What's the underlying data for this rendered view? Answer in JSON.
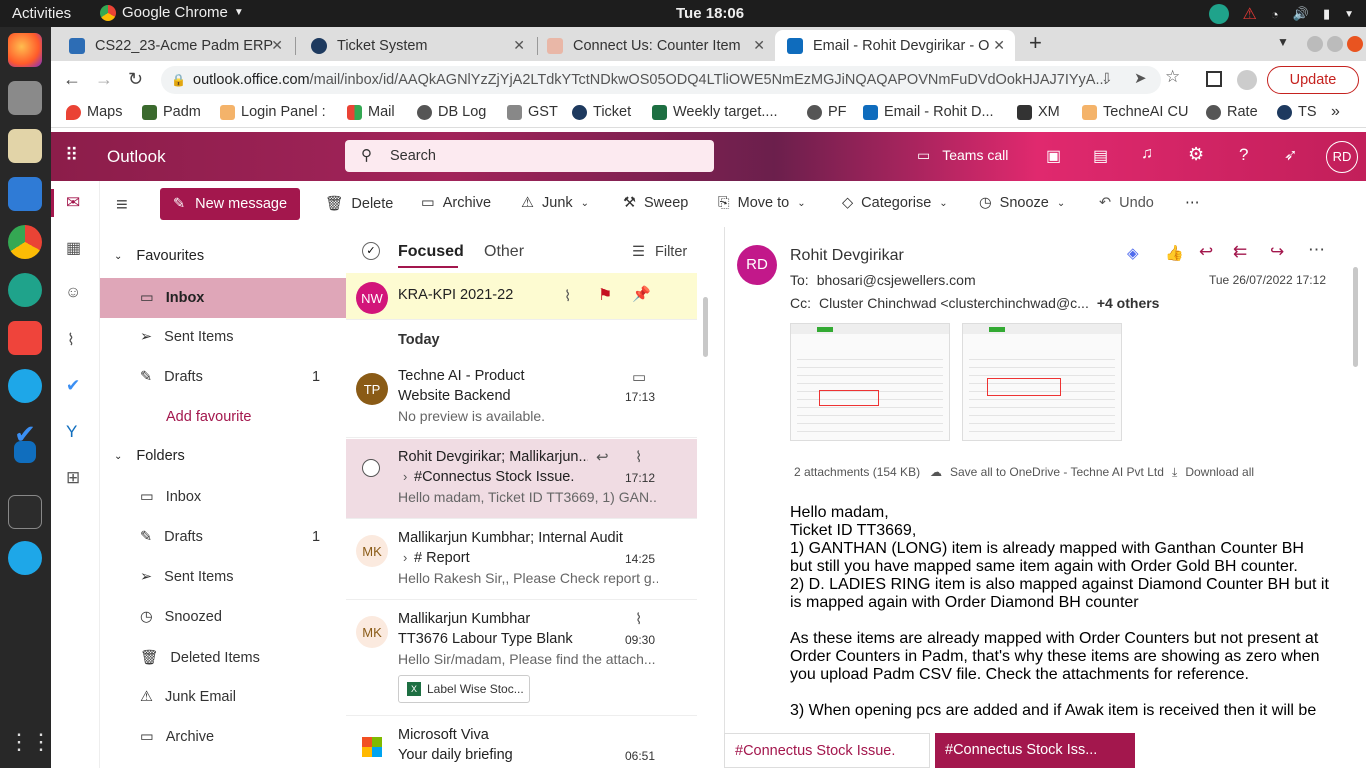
{
  "system": {
    "activities": "Activities",
    "app_name": "Google Chrome",
    "clock": "Tue 18:06"
  },
  "chrome": {
    "tabs": [
      {
        "title": "CS22_23-Acme Padm ERP"
      },
      {
        "title": "Ticket System"
      },
      {
        "title": "Connect Us: Counter Item"
      },
      {
        "title": "Email - Rohit Devgirikar - O"
      }
    ],
    "url_host": "outlook.office.com",
    "url_path": "/mail/inbox/id/AAQkAGNlYzZjYjA2LTdkYTctNDkwOS05ODQ4LTliOWE5NmEzMGJiNQAQAPOVNmFuDVdOokHJAJ7IYyA...",
    "update_label": "Update",
    "profile_initial": "",
    "bookmarks": [
      "Maps",
      "Padm",
      "Login Panel :",
      "Mail",
      "DB Log",
      "GST",
      "Ticket",
      "Weekly target....",
      "PF",
      "Email - Rohit D...",
      "XM",
      "TechneAI CU",
      "Rate",
      "TS"
    ]
  },
  "outlook": {
    "brand": "Outlook",
    "search_placeholder": "Search",
    "teams_call": "Teams call",
    "user_initials": "RD",
    "ribbon": {
      "new_message": "New message",
      "delete": "Delete",
      "archive": "Archive",
      "junk": "Junk",
      "sweep": "Sweep",
      "move_to": "Move to",
      "categorise": "Categorise",
      "snooze": "Snooze",
      "undo": "Undo"
    },
    "nav": {
      "favourites": "Favourites",
      "fav_items": [
        {
          "label": "Inbox",
          "count": ""
        },
        {
          "label": "Sent Items",
          "count": ""
        },
        {
          "label": "Drafts",
          "count": "1"
        }
      ],
      "add_favourite": "Add favourite",
      "folders": "Folders",
      "folder_items": [
        {
          "label": "Inbox",
          "count": ""
        },
        {
          "label": "Drafts",
          "count": "1"
        },
        {
          "label": "Sent Items",
          "count": ""
        },
        {
          "label": "Snoozed",
          "count": ""
        },
        {
          "label": "Deleted Items",
          "count": ""
        },
        {
          "label": "Junk Email",
          "count": ""
        },
        {
          "label": "Archive",
          "count": ""
        }
      ]
    },
    "list": {
      "focused": "Focused",
      "other": "Other",
      "filter": "Filter",
      "pinned": {
        "initials": "NW",
        "subject": "KRA-KPI 2021-22"
      },
      "today": "Today",
      "messages": [
        {
          "initials": "TP",
          "sender": "Techne AI - Product",
          "subject": "Website Backend",
          "preview": "No preview is available.",
          "time": "17:13"
        },
        {
          "initials": "",
          "sender": "Rohit Devgirikar; Mallikarjun...",
          "subject": "#Connectus Stock Issue.",
          "preview": "Hello madam, Ticket ID TT3669, 1) GAN...",
          "time": "17:12"
        },
        {
          "initials": "MK",
          "sender": "Mallikarjun Kumbhar; Internal Audit",
          "subject": "# Report",
          "preview": "Hello Rakesh Sir,, Please Check report g...",
          "time": "14:25"
        },
        {
          "initials": "MK",
          "sender": "Mallikarjun Kumbhar",
          "subject": "TT3676 Labour Type Blank",
          "preview": "Hello Sir/madam, Please find the attach...",
          "time": "09:30",
          "attachment": "Label Wise Stoc..."
        },
        {
          "initials": "",
          "sender": "Microsoft Viva",
          "subject": "Your daily briefing",
          "preview": "",
          "time": "06:51"
        }
      ]
    },
    "reading": {
      "avatar": "RD",
      "from": "Rohit Devgirikar",
      "to_label": "To:",
      "to": "bhosari@csjewellers.com",
      "cc_label": "Cc:",
      "cc": "Cluster Chinchwad <clusterchinchwad@c...",
      "cc_more": "+4 others",
      "date": "Tue 26/07/2022 17:12",
      "attachments_info": "2 attachments (154 KB)",
      "save_all": "Save all to OneDrive - Techne AI Pvt Ltd",
      "download_all": "Download all",
      "body": [
        "Hello madam,",
        "Ticket ID TT3669,",
        "1) GANTHAN (LONG) item is already mapped with Ganthan Counter BH but still you have mapped same item again with Order Gold BH counter.",
        "2) D. LADIES RING item is also mapped against Diamond Counter BH but it is mapped again with Order Diamond BH counter",
        "As these items are already mapped with Order Counters but not present at Order Counters in Padm, that's why these items are showing as zero when you upload Padm CSV file. Check the attachments for reference.",
        "3) When opening pcs are added and if Awak item is received then it will be"
      ]
    },
    "bottom_tabs": [
      "#Connectus Stock Issue.",
      "#Connectus Stock Iss..."
    ]
  }
}
